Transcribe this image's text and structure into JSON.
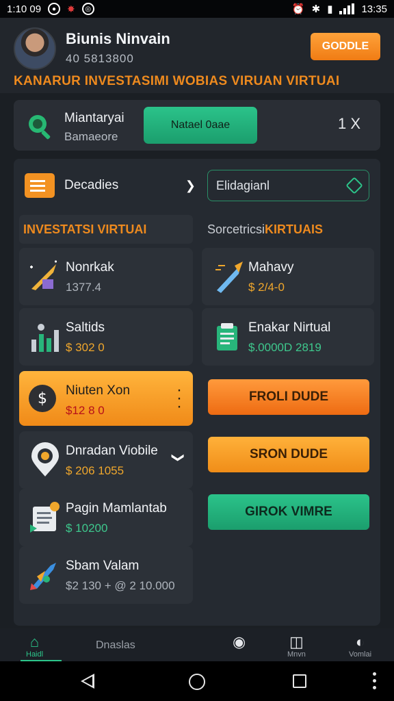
{
  "status_bar": {
    "time_left": "1:10 09",
    "time_right": "13:35"
  },
  "header": {
    "user_name": "Biunis Ninvain",
    "user_id": "40 5813800",
    "action_button": "GODDLE",
    "banner": "KANARUR INVESTASIMI WOBIAS VIRUAN VIRTUAI"
  },
  "promo": {
    "title": "Miantaryai",
    "subtitle": "Bamaeore",
    "button": "Natael 0aae",
    "close_label": "1 X"
  },
  "controls": {
    "dropdown_label": "Decadies",
    "field_value": "Elidagianl"
  },
  "sections": {
    "left_title": "INVESTATSI VIRTUAI",
    "right_title_plain": "Sorcetricsi ",
    "right_title_accent": "KIRTUAIS"
  },
  "left_items": [
    {
      "name": "Nonrkak",
      "value": "1377.4"
    },
    {
      "name": "Saltids",
      "value": "$ 302 0"
    },
    {
      "name": "Niuten Xon",
      "value": "$12 8 0"
    },
    {
      "name": "Dnradan Viobile",
      "value": "$ 206 1055"
    },
    {
      "name": "Pagin Mamlantab",
      "value": "$ 10200"
    },
    {
      "name": "Sbam Valam",
      "value": "$2 130 + @ 2 10.000"
    }
  ],
  "right_items": [
    {
      "name": "Mahavy",
      "value": "$ 2/4-0"
    },
    {
      "name": "Enakar Nirtual",
      "value": "$.0000D 2819"
    }
  ],
  "action_buttons": {
    "first": "FROLI DUDE",
    "second": "SRON DUDE",
    "third": "GIROK VIMRE"
  },
  "tabs": [
    {
      "label": "Haidl",
      "icon": "home-icon"
    },
    {
      "label": "Dnaslas",
      "icon": ""
    },
    {
      "label": "",
      "icon": "coin-icon"
    },
    {
      "label": "Mnvn",
      "icon": "book-icon"
    },
    {
      "label": "Vomlai",
      "icon": "chat-icon"
    }
  ],
  "colors": {
    "accent_orange": "#f08a18",
    "accent_green": "#2cc58a",
    "background": "#1b1f24",
    "card": "#2c3138"
  }
}
